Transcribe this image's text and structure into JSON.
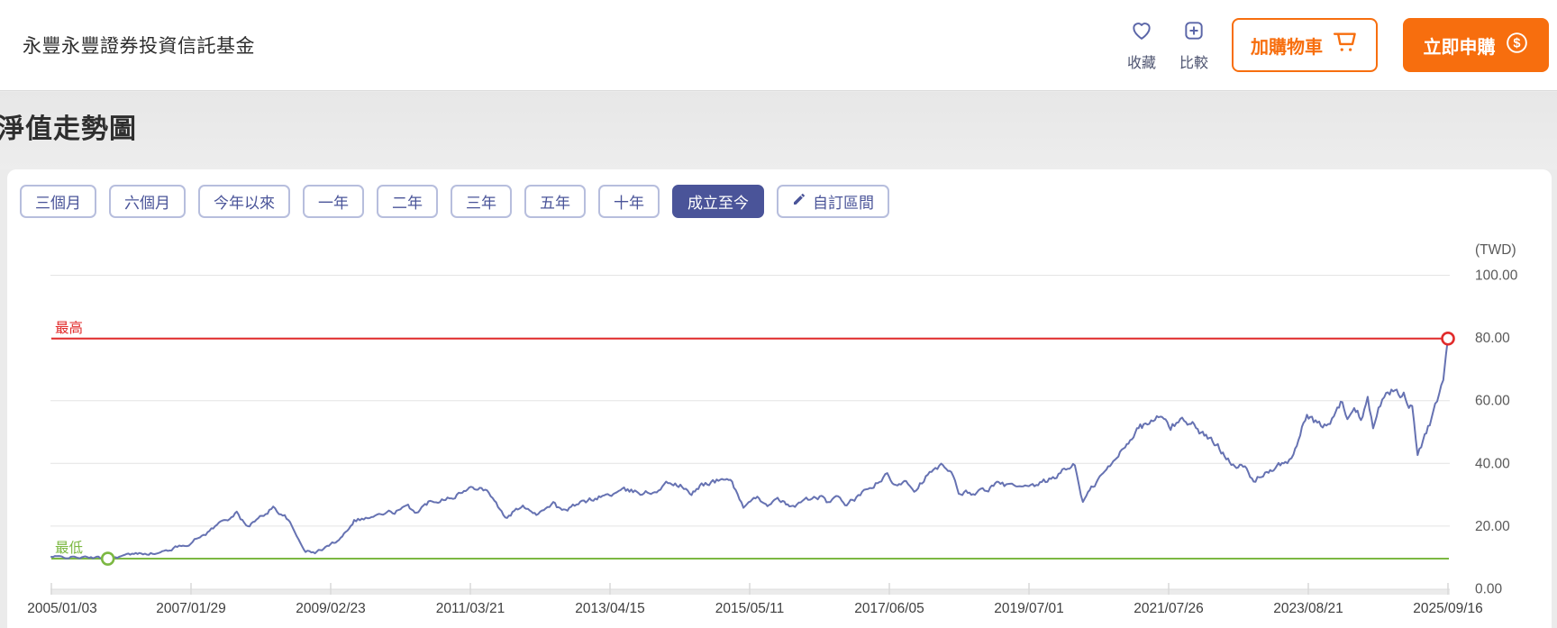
{
  "header": {
    "fund_name": "永豐永豐證券投資信託基金",
    "favorite_label": "收藏",
    "compare_label": "比較",
    "add_cart_label": "加購物車",
    "subscribe_label": "立即申購"
  },
  "section": {
    "title": "淨值走勢圖"
  },
  "periods": {
    "items": [
      {
        "label": "三個月",
        "selected": false
      },
      {
        "label": "六個月",
        "selected": false
      },
      {
        "label": "今年以來",
        "selected": false
      },
      {
        "label": "一年",
        "selected": false
      },
      {
        "label": "二年",
        "selected": false
      },
      {
        "label": "三年",
        "selected": false
      },
      {
        "label": "五年",
        "selected": false
      },
      {
        "label": "十年",
        "selected": false
      },
      {
        "label": "成立至今",
        "selected": true
      },
      {
        "label": "自訂區間",
        "selected": false,
        "icon": "pencil-icon"
      }
    ]
  },
  "chart_data": {
    "type": "line",
    "title": "淨值走勢圖",
    "unit_label": "(TWD)",
    "currency": "TWD",
    "grid": true,
    "legend": "none",
    "y_range": [
      0,
      100
    ],
    "y_ticks": [
      {
        "value": 100,
        "label": "100.00"
      },
      {
        "value": 80,
        "label": "80.00"
      },
      {
        "value": 60,
        "label": "60.00"
      },
      {
        "value": 40,
        "label": "40.00"
      },
      {
        "value": 20,
        "label": "20.00"
      },
      {
        "value": 0,
        "label": "0.00"
      }
    ],
    "x_tick_labels": [
      "2005/01/03",
      "2007/01/29",
      "2009/02/23",
      "2011/03/21",
      "2013/04/15",
      "2015/05/11",
      "2017/06/05",
      "2019/07/01",
      "2021/07/26",
      "2023/08/21",
      "2025/09/16"
    ],
    "x_range_years": [
      2005.013,
      2025.71
    ],
    "annotations": {
      "max": {
        "label": "最高",
        "value": 79.8,
        "at_year": 2025.71,
        "color": "#e12b2b"
      },
      "min": {
        "label": "最低",
        "value": 9.61,
        "at_year": 2005.85,
        "color": "#7cb842"
      }
    },
    "series": [
      {
        "name": "淨值",
        "color": "#6672b2",
        "points": [
          [
            2005.013,
            10.0
          ],
          [
            2005.3,
            9.9
          ],
          [
            2005.6,
            9.75
          ],
          [
            2005.85,
            9.61
          ],
          [
            2006.1,
            10.5
          ],
          [
            2006.4,
            11.3
          ],
          [
            2006.6,
            11.1
          ],
          [
            2006.85,
            13.0
          ],
          [
            2007.05,
            14.3
          ],
          [
            2007.3,
            17.5
          ],
          [
            2007.55,
            21.5
          ],
          [
            2007.76,
            23.9
          ],
          [
            2007.9,
            19.8
          ],
          [
            2008.05,
            21.5
          ],
          [
            2008.3,
            25.9
          ],
          [
            2008.5,
            22.5
          ],
          [
            2008.65,
            16.5
          ],
          [
            2008.78,
            12.0
          ],
          [
            2008.92,
            11.3
          ],
          [
            2009.05,
            12.8
          ],
          [
            2009.2,
            14.5
          ],
          [
            2009.35,
            17.5
          ],
          [
            2009.5,
            21.9
          ],
          [
            2009.7,
            22.5
          ],
          [
            2009.9,
            23.5
          ],
          [
            2010.1,
            24.5
          ],
          [
            2010.3,
            25.8
          ],
          [
            2010.45,
            24.3
          ],
          [
            2010.6,
            27.5
          ],
          [
            2010.8,
            28.7
          ],
          [
            2011.05,
            30.2
          ],
          [
            2011.36,
            33.0
          ],
          [
            2011.55,
            29.5
          ],
          [
            2011.74,
            22.1
          ],
          [
            2011.9,
            25.0
          ],
          [
            2012.05,
            26.0
          ],
          [
            2012.2,
            23.9
          ],
          [
            2012.45,
            27.3
          ],
          [
            2012.58,
            24.4
          ],
          [
            2012.85,
            27.0
          ],
          [
            2013.1,
            29.0
          ],
          [
            2013.5,
            31.0
          ],
          [
            2013.9,
            30.5
          ],
          [
            2014.18,
            33.9
          ],
          [
            2014.36,
            32.5
          ],
          [
            2014.5,
            29.6
          ],
          [
            2014.65,
            33.3
          ],
          [
            2014.9,
            34.2
          ],
          [
            2015.05,
            35.3
          ],
          [
            2015.18,
            30.5
          ],
          [
            2015.27,
            25.9
          ],
          [
            2015.5,
            28.7
          ],
          [
            2015.65,
            26.7
          ],
          [
            2015.8,
            28.2
          ],
          [
            2015.95,
            25.9
          ],
          [
            2016.2,
            28.2
          ],
          [
            2016.4,
            29.1
          ],
          [
            2016.5,
            27.6
          ],
          [
            2016.7,
            28.7
          ],
          [
            2016.8,
            26.7
          ],
          [
            2017.0,
            29.6
          ],
          [
            2017.2,
            32.8
          ],
          [
            2017.4,
            35.9
          ],
          [
            2017.5,
            32.5
          ],
          [
            2017.68,
            35.0
          ],
          [
            2017.8,
            31.6
          ],
          [
            2018.0,
            36.2
          ],
          [
            2018.2,
            38.8
          ],
          [
            2018.35,
            36.2
          ],
          [
            2018.46,
            30.5
          ],
          [
            2018.7,
            30.5
          ],
          [
            2018.9,
            31.9
          ],
          [
            2019.05,
            33.3
          ],
          [
            2019.25,
            32.5
          ],
          [
            2019.5,
            31.6
          ],
          [
            2019.8,
            34.5
          ],
          [
            2020.05,
            38.0
          ],
          [
            2020.18,
            39.7
          ],
          [
            2020.3,
            27.6
          ],
          [
            2020.45,
            32.5
          ],
          [
            2020.6,
            36.5
          ],
          [
            2020.75,
            40.0
          ],
          [
            2020.9,
            45.0
          ],
          [
            2021.05,
            49.5
          ],
          [
            2021.2,
            52.0
          ],
          [
            2021.45,
            54.6
          ],
          [
            2021.6,
            51.5
          ],
          [
            2021.8,
            54.0
          ],
          [
            2021.95,
            52.0
          ],
          [
            2022.1,
            49.0
          ],
          [
            2022.25,
            46.0
          ],
          [
            2022.4,
            43.1
          ],
          [
            2022.55,
            39.7
          ],
          [
            2022.7,
            38.2
          ],
          [
            2022.83,
            33.9
          ],
          [
            2023.0,
            37.4
          ],
          [
            2023.15,
            37.6
          ],
          [
            2023.3,
            40.5
          ],
          [
            2023.42,
            42.0
          ],
          [
            2023.52,
            48.8
          ],
          [
            2023.62,
            56.0
          ],
          [
            2023.72,
            52.6
          ],
          [
            2023.88,
            51.5
          ],
          [
            2024.02,
            54.9
          ],
          [
            2024.12,
            59.2
          ],
          [
            2024.22,
            55.5
          ],
          [
            2024.32,
            56.9
          ],
          [
            2024.42,
            54.6
          ],
          [
            2024.52,
            61.2
          ],
          [
            2024.6,
            52.6
          ],
          [
            2024.68,
            57.5
          ],
          [
            2024.82,
            62.5
          ],
          [
            2024.95,
            64.1
          ],
          [
            2025.08,
            61.2
          ],
          [
            2025.18,
            57.5
          ],
          [
            2025.26,
            42.0
          ],
          [
            2025.34,
            46.8
          ],
          [
            2025.44,
            52.6
          ],
          [
            2025.52,
            57.5
          ],
          [
            2025.58,
            61.2
          ],
          [
            2025.64,
            66.0
          ],
          [
            2025.68,
            73.0
          ],
          [
            2025.71,
            79.8
          ]
        ]
      }
    ]
  },
  "colors": {
    "accent_indigo": "#4a5499",
    "accent_orange": "#f76e0e",
    "max_red": "#e12b2b",
    "min_green": "#7cb842",
    "series_blue": "#6672b2",
    "grid": "#e4e4e4"
  }
}
